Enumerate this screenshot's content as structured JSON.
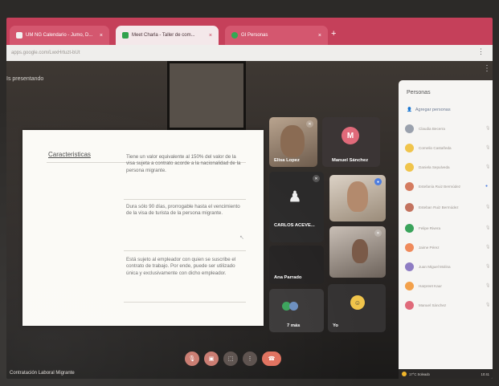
{
  "browser": {
    "tabs": [
      {
        "label": "UM NG Calendario - Jumo, D...",
        "favicon_color": "#f2f2f2"
      },
      {
        "label": "Meet Charla - Taller de com...",
        "favicon_color": "#31a24c"
      },
      {
        "label": "GI Personas",
        "favicon_color": "#34a853"
      }
    ],
    "new_tab": "+",
    "close_glyph": "×",
    "url": "apps.google.com/LwxHrtuzt-bUt",
    "menu_glyph": "⋮"
  },
  "meet": {
    "presenting_label": "Is presentando",
    "slide": {
      "heading": "Caracteristicas",
      "paragraphs": [
        "Tiene un valor equivalente al 150% del valor de la visa sujeta a contrato acorde a la nacionalidad de la persona migrante.",
        "Dura sólo 90 días, prorrogable hasta el vencimiento de la visa de turista de la persona migrante.",
        "Está sujeto al empleador con quien se suscribe el contrato de trabajo. Por ende, puede ser utilizado única y exclusivamente con dicho empleador."
      ]
    },
    "tiles": [
      {
        "name": "Elisa Lopez",
        "type": "video"
      },
      {
        "name": "Manuel Sánchez",
        "initial": "M",
        "avatar_color": "#e06a7a",
        "type": "avatar"
      },
      {
        "name": "CARLOS ACEVE...",
        "type": "icon"
      },
      {
        "name": "",
        "type": "video"
      },
      {
        "name": "Ana Parrado",
        "type": "dark"
      },
      {
        "name": "",
        "type": "video"
      },
      {
        "name": "7 más",
        "type": "more"
      },
      {
        "name": "Yo",
        "type": "self"
      }
    ],
    "controls": [
      "mic",
      "camera",
      "present",
      "more",
      "end"
    ],
    "bottom_title": "Contratación Laboral Migrante"
  },
  "people": {
    "title": "Personas",
    "add_label": "Agregar personas",
    "items": [
      {
        "name": "Claudia Becerra",
        "color": "#9aa1ad"
      },
      {
        "name": "Cornelio Castañeda",
        "color": "#f0c44b"
      },
      {
        "name": "Daniela Sepulveda",
        "color": "#f0c44b"
      },
      {
        "name": "Estefanía Ruiz Bermúdez",
        "color": "#d47b5f"
      },
      {
        "name": "Esteban Ruiz Bermúdez",
        "color": "#c3735f"
      },
      {
        "name": "Felipe Rivera",
        "color": "#3aa35b"
      },
      {
        "name": "Jaime Pérez",
        "color": "#ef8a5b"
      },
      {
        "name": "Juan Miguel Molina",
        "color": "#8e7cc3"
      },
      {
        "name": "Harpreet Kaur",
        "color": "#f3a04a"
      },
      {
        "name": "Manuel Sánchez",
        "color": "#e06a7a"
      }
    ]
  },
  "tray": {
    "weather": "17°C Soleado",
    "time": "10:41"
  }
}
